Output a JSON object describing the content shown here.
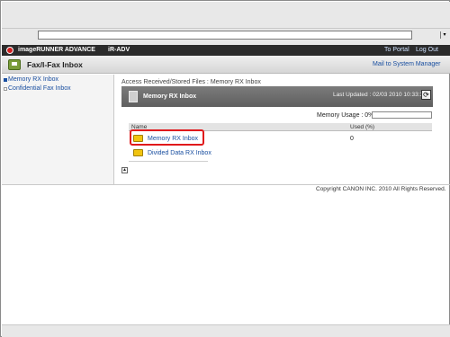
{
  "app": {
    "brand": "imageRUNNER ADVANCE",
    "device": "iR-ADV",
    "to_portal": "To Portal",
    "log_out": "Log Out"
  },
  "section": {
    "title": "Fax/I-Fax Inbox",
    "mail_link": "Mail to System Manager"
  },
  "sidebar": {
    "items": [
      {
        "label": "Memory RX Inbox",
        "active": true
      },
      {
        "label": "Confidential Fax Inbox",
        "active": false
      }
    ]
  },
  "breadcrumb": "Access Received/Stored Files : Memory RX Inbox",
  "panel": {
    "title": "Memory RX Inbox",
    "last_updated": "Last Updated : 02/03 2010 10:33:32"
  },
  "memory": {
    "label": "Memory Usage : 0%",
    "usage_fraction": 0.0
  },
  "table": {
    "headers": [
      "Name",
      "Used (%)"
    ],
    "rows": [
      {
        "name": "Memory RX Inbox",
        "used": "0",
        "highlighted": true
      },
      {
        "name": "Divided Data RX Inbox",
        "used": "",
        "highlighted": false
      }
    ]
  },
  "footer": {
    "copyright": "Copyright CANON INC. 2010 All Rights Reserved."
  },
  "colors": {
    "accent_link": "#1a4fa0",
    "app_bar": "#2b2b2b",
    "highlight": "#e0191b"
  },
  "icons": {
    "logo": "canon-logo-icon",
    "section": "fax-icon",
    "refresh": "refresh-icon",
    "folder": "folder-icon",
    "up": "up-icon"
  }
}
